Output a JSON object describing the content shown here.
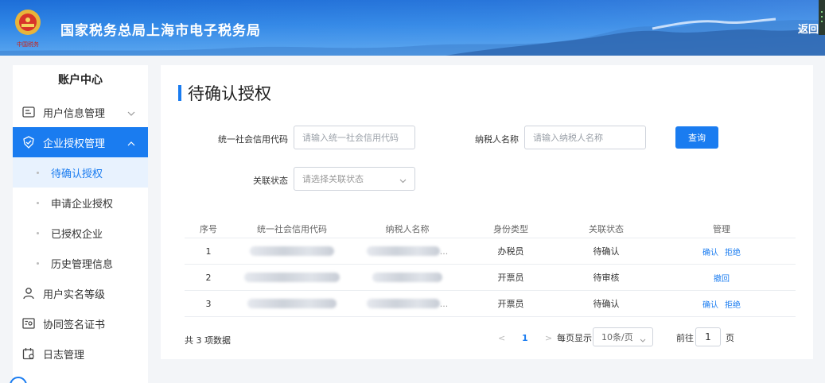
{
  "header": {
    "title": "国家税务总局上海市电子税务局",
    "back_label": "返回",
    "colors": {
      "banner": "#2f86e6"
    }
  },
  "sidebar": {
    "title": "账户中心",
    "items": [
      {
        "label": "用户信息管理",
        "icon": "id-card-icon"
      },
      {
        "label": "企业授权管理",
        "icon": "shield-check-icon"
      },
      {
        "label": "用户实名等级",
        "icon": "user-icon"
      },
      {
        "label": "协同签名证书",
        "icon": "certificate-icon"
      },
      {
        "label": "日志管理",
        "icon": "calendar-log-icon"
      }
    ],
    "subitems": [
      {
        "label": "待确认授权"
      },
      {
        "label": "申请企业授权"
      },
      {
        "label": "已授权企业"
      },
      {
        "label": "历史管理信息"
      }
    ]
  },
  "main": {
    "title": "待确认授权",
    "filters": {
      "credit_code_label": "统一社会信用代码",
      "credit_code_placeholder": "请输入统一社会信用代码",
      "taxpayer_label": "纳税人名称",
      "taxpayer_placeholder": "请输入纳税人名称",
      "status_label": "关联状态",
      "status_placeholder": "请选择关联状态",
      "query_label": "查询"
    },
    "table": {
      "headers": [
        "序号",
        "统一社会信用代码",
        "纳税人名称",
        "身份类型",
        "关联状态",
        "管理"
      ],
      "rows": [
        {
          "index": "1",
          "name_suffix": "...",
          "role": "办税员",
          "status": "待确认",
          "actions": [
            "确认",
            "拒绝"
          ]
        },
        {
          "index": "2",
          "name_suffix": "",
          "role": "开票员",
          "status": "待审核",
          "actions": [
            "撤回"
          ]
        },
        {
          "index": "3",
          "name_suffix": "...",
          "role": "开票员",
          "status": "待确认",
          "actions": [
            "确认",
            "拒绝"
          ]
        }
      ]
    },
    "pagination": {
      "total_text": "共 3 项数据",
      "prev": "<",
      "current_page": "1",
      "next": ">",
      "per_page_label": "每页显示",
      "page_size": "10条/页",
      "goto_label": "前往",
      "goto_value": "1",
      "page_unit": "页"
    }
  },
  "colors": {
    "accent": "#1a7cf0"
  }
}
